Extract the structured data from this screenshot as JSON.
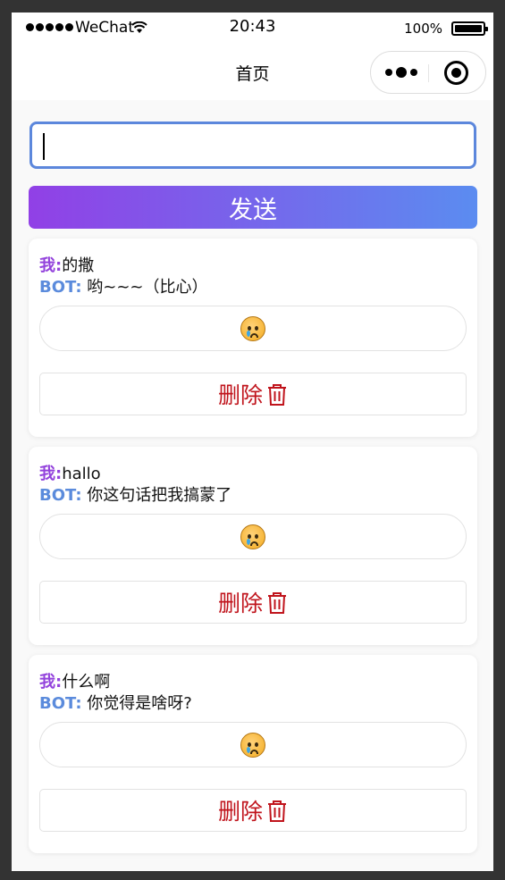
{
  "status_bar": {
    "carrier": "WeChat",
    "time": "20:43",
    "battery": "100%"
  },
  "nav": {
    "title": "首页"
  },
  "input": {
    "value": "",
    "placeholder": ""
  },
  "send_label": "发送",
  "labels": {
    "me": "我:",
    "bot": "BOT:"
  },
  "delete_label": "删除",
  "messages": [
    {
      "user": "的撒",
      "bot": "哟~~~（比心）"
    },
    {
      "user": "hallo",
      "bot": "你这句话把我搞蒙了"
    },
    {
      "user": "什么啊",
      "bot": "你觉得是啥呀?"
    }
  ],
  "colors": {
    "accent": "#5c87dc",
    "gradient_start": "#9140e6",
    "gradient_end": "#5b8cf0",
    "me_label": "#9343dc",
    "bot_label": "#5b8bdc",
    "delete": "#c0141c"
  },
  "icons": {
    "reaction": "sad-crying-face-icon",
    "delete": "trash-icon"
  }
}
